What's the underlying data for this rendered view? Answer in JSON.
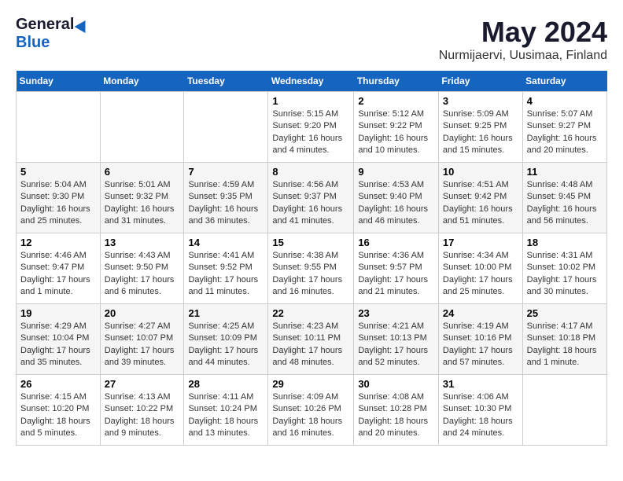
{
  "header": {
    "logo": {
      "general": "General",
      "blue": "Blue"
    },
    "title": "May 2024",
    "location": "Nurmijaervi, Uusimaa, Finland"
  },
  "weekdays": [
    "Sunday",
    "Monday",
    "Tuesday",
    "Wednesday",
    "Thursday",
    "Friday",
    "Saturday"
  ],
  "weeks": [
    [
      {
        "num": "",
        "info": ""
      },
      {
        "num": "",
        "info": ""
      },
      {
        "num": "",
        "info": ""
      },
      {
        "num": "1",
        "info": "Sunrise: 5:15 AM\nSunset: 9:20 PM\nDaylight: 16 hours\nand 4 minutes."
      },
      {
        "num": "2",
        "info": "Sunrise: 5:12 AM\nSunset: 9:22 PM\nDaylight: 16 hours\nand 10 minutes."
      },
      {
        "num": "3",
        "info": "Sunrise: 5:09 AM\nSunset: 9:25 PM\nDaylight: 16 hours\nand 15 minutes."
      },
      {
        "num": "4",
        "info": "Sunrise: 5:07 AM\nSunset: 9:27 PM\nDaylight: 16 hours\nand 20 minutes."
      }
    ],
    [
      {
        "num": "5",
        "info": "Sunrise: 5:04 AM\nSunset: 9:30 PM\nDaylight: 16 hours\nand 25 minutes."
      },
      {
        "num": "6",
        "info": "Sunrise: 5:01 AM\nSunset: 9:32 PM\nDaylight: 16 hours\nand 31 minutes."
      },
      {
        "num": "7",
        "info": "Sunrise: 4:59 AM\nSunset: 9:35 PM\nDaylight: 16 hours\nand 36 minutes."
      },
      {
        "num": "8",
        "info": "Sunrise: 4:56 AM\nSunset: 9:37 PM\nDaylight: 16 hours\nand 41 minutes."
      },
      {
        "num": "9",
        "info": "Sunrise: 4:53 AM\nSunset: 9:40 PM\nDaylight: 16 hours\nand 46 minutes."
      },
      {
        "num": "10",
        "info": "Sunrise: 4:51 AM\nSunset: 9:42 PM\nDaylight: 16 hours\nand 51 minutes."
      },
      {
        "num": "11",
        "info": "Sunrise: 4:48 AM\nSunset: 9:45 PM\nDaylight: 16 hours\nand 56 minutes."
      }
    ],
    [
      {
        "num": "12",
        "info": "Sunrise: 4:46 AM\nSunset: 9:47 PM\nDaylight: 17 hours\nand 1 minute."
      },
      {
        "num": "13",
        "info": "Sunrise: 4:43 AM\nSunset: 9:50 PM\nDaylight: 17 hours\nand 6 minutes."
      },
      {
        "num": "14",
        "info": "Sunrise: 4:41 AM\nSunset: 9:52 PM\nDaylight: 17 hours\nand 11 minutes."
      },
      {
        "num": "15",
        "info": "Sunrise: 4:38 AM\nSunset: 9:55 PM\nDaylight: 17 hours\nand 16 minutes."
      },
      {
        "num": "16",
        "info": "Sunrise: 4:36 AM\nSunset: 9:57 PM\nDaylight: 17 hours\nand 21 minutes."
      },
      {
        "num": "17",
        "info": "Sunrise: 4:34 AM\nSunset: 10:00 PM\nDaylight: 17 hours\nand 25 minutes."
      },
      {
        "num": "18",
        "info": "Sunrise: 4:31 AM\nSunset: 10:02 PM\nDaylight: 17 hours\nand 30 minutes."
      }
    ],
    [
      {
        "num": "19",
        "info": "Sunrise: 4:29 AM\nSunset: 10:04 PM\nDaylight: 17 hours\nand 35 minutes."
      },
      {
        "num": "20",
        "info": "Sunrise: 4:27 AM\nSunset: 10:07 PM\nDaylight: 17 hours\nand 39 minutes."
      },
      {
        "num": "21",
        "info": "Sunrise: 4:25 AM\nSunset: 10:09 PM\nDaylight: 17 hours\nand 44 minutes."
      },
      {
        "num": "22",
        "info": "Sunrise: 4:23 AM\nSunset: 10:11 PM\nDaylight: 17 hours\nand 48 minutes."
      },
      {
        "num": "23",
        "info": "Sunrise: 4:21 AM\nSunset: 10:13 PM\nDaylight: 17 hours\nand 52 minutes."
      },
      {
        "num": "24",
        "info": "Sunrise: 4:19 AM\nSunset: 10:16 PM\nDaylight: 17 hours\nand 57 minutes."
      },
      {
        "num": "25",
        "info": "Sunrise: 4:17 AM\nSunset: 10:18 PM\nDaylight: 18 hours\nand 1 minute."
      }
    ],
    [
      {
        "num": "26",
        "info": "Sunrise: 4:15 AM\nSunset: 10:20 PM\nDaylight: 18 hours\nand 5 minutes."
      },
      {
        "num": "27",
        "info": "Sunrise: 4:13 AM\nSunset: 10:22 PM\nDaylight: 18 hours\nand 9 minutes."
      },
      {
        "num": "28",
        "info": "Sunrise: 4:11 AM\nSunset: 10:24 PM\nDaylight: 18 hours\nand 13 minutes."
      },
      {
        "num": "29",
        "info": "Sunrise: 4:09 AM\nSunset: 10:26 PM\nDaylight: 18 hours\nand 16 minutes."
      },
      {
        "num": "30",
        "info": "Sunrise: 4:08 AM\nSunset: 10:28 PM\nDaylight: 18 hours\nand 20 minutes."
      },
      {
        "num": "31",
        "info": "Sunrise: 4:06 AM\nSunset: 10:30 PM\nDaylight: 18 hours\nand 24 minutes."
      },
      {
        "num": "",
        "info": ""
      }
    ]
  ]
}
